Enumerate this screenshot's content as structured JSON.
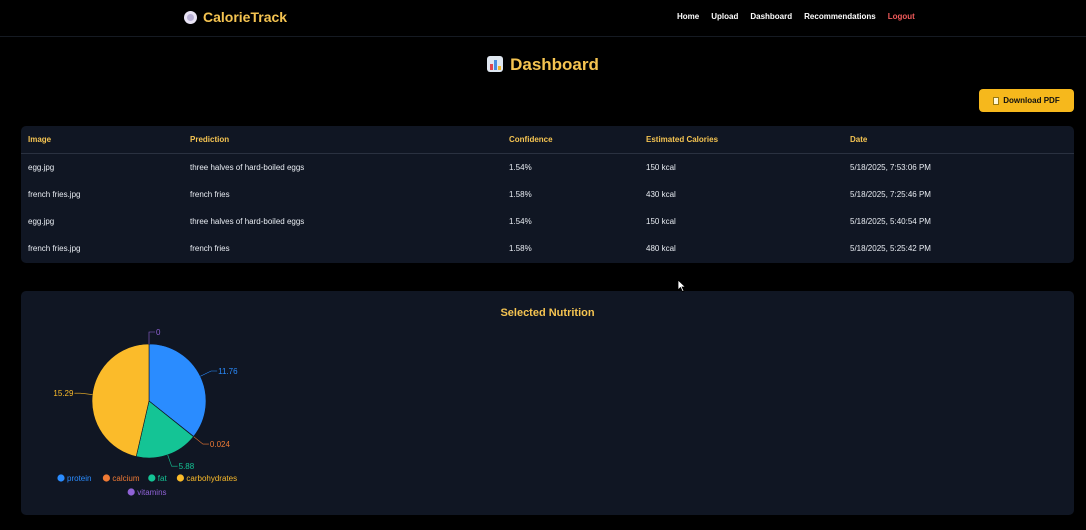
{
  "nav": {
    "brand": "CalorieTrack",
    "links": [
      "Home",
      "Upload",
      "Dashboard",
      "Recommendations",
      "Logout"
    ]
  },
  "page": {
    "title": "Dashboard"
  },
  "toolbar": {
    "download_label": "Download PDF"
  },
  "table": {
    "headers": [
      "Image",
      "Prediction",
      "Confidence",
      "Estimated Calories",
      "Date"
    ],
    "rows": [
      [
        "egg.jpg",
        "three halves of hard-boiled eggs",
        "1.54%",
        "150 kcal",
        "5/18/2025, 7:53:06 PM"
      ],
      [
        "french fries.jpg",
        "french fries",
        "1.58%",
        "430 kcal",
        "5/18/2025, 7:25:46 PM"
      ],
      [
        "egg.jpg",
        "three halves of hard-boiled eggs",
        "1.54%",
        "150 kcal",
        "5/18/2025, 5:40:54 PM"
      ],
      [
        "french fries.jpg",
        "french fries",
        "1.58%",
        "480 kcal",
        "5/18/2025, 5:25:42 PM"
      ]
    ]
  },
  "chart_data": {
    "type": "pie",
    "title": "Selected Nutrition",
    "labels": [
      "protein",
      "calcium",
      "fat",
      "carbohydrates",
      "vitamins"
    ],
    "values": [
      11.76,
      0.024,
      5.88,
      15.29,
      0
    ],
    "data_labels": [
      "11.76",
      "0.024",
      "5.88",
      "15.29",
      "0"
    ],
    "colors": [
      "#2a8cff",
      "#f07a34",
      "#14c495",
      "#fbbb2a",
      "#8f62d6"
    ],
    "legend": "bottom"
  }
}
